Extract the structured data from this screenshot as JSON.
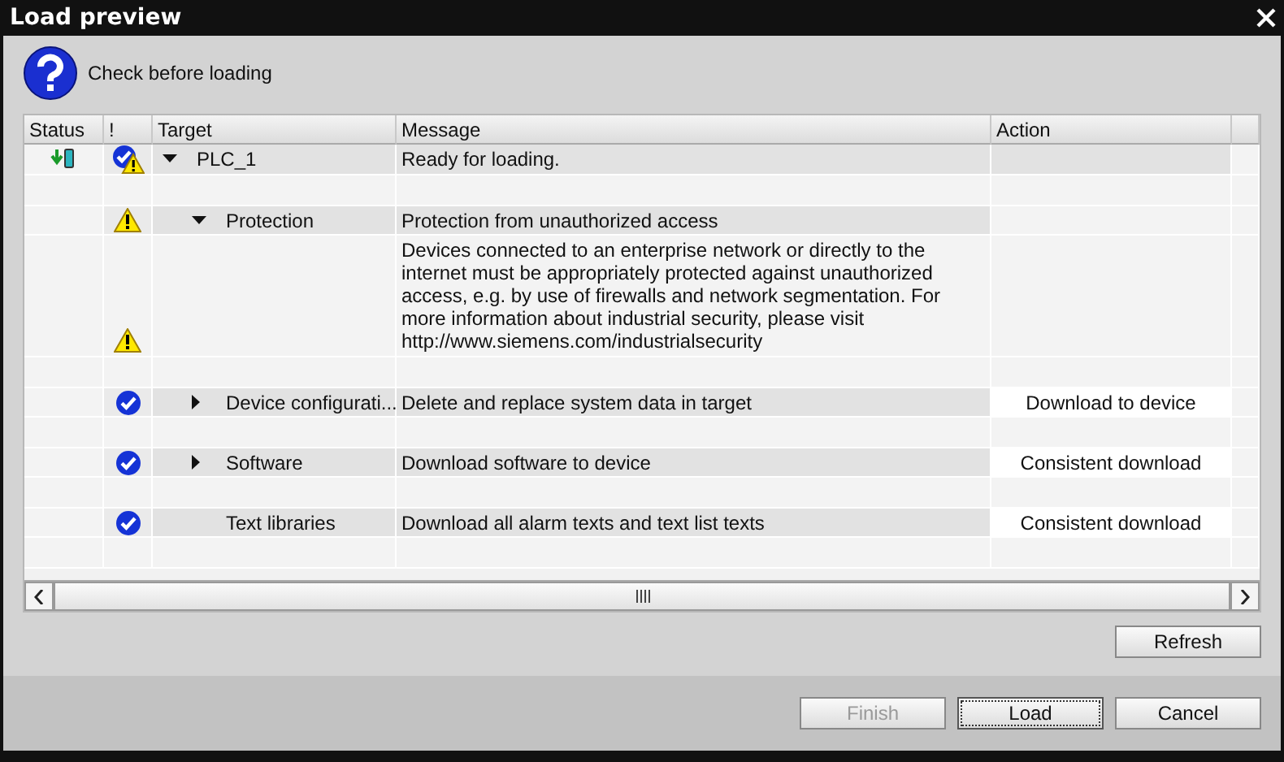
{
  "window": {
    "title": "Load preview"
  },
  "header": {
    "text": "Check before loading"
  },
  "table": {
    "columns": [
      "Status",
      "!",
      "Target",
      "Message",
      "Action"
    ],
    "rows": [
      {
        "target": "PLC_1",
        "download": true,
        "ok": true,
        "warning": true,
        "expanded": true,
        "message": "Ready for loading.",
        "spacer": true,
        "children": [
          {
            "target": "Protection",
            "download": false,
            "ok": false,
            "warning": true,
            "expanded": true,
            "message": "Protection from unauthorized access",
            "spacer": false,
            "children": [
              {
                "download": false,
                "ok": false,
                "warning": true,
                "message": "Devices connected to an enterprise network or directly to the internet must be appropriately protected against unauthorized access, e.g. by use of firewalls and network segmentation. For more information about industrial security, please visit http://www.siemens.com/industrialsecurity",
                "spacer": true
              }
            ]
          },
          {
            "target": "Device configurati...",
            "download": false,
            "ok": true,
            "warning": false,
            "expanded": false,
            "message": "Delete and replace system data in target",
            "action": "Download to device",
            "spacer": true
          },
          {
            "target": "Software",
            "download": false,
            "ok": true,
            "warning": false,
            "expanded": false,
            "message": "Download software to device",
            "action": "Consistent download",
            "spacer": true
          },
          {
            "target": "Text libraries",
            "download": false,
            "ok": true,
            "warning": false,
            "message": "Download all alarm texts and text list texts",
            "action": "Consistent download",
            "spacer": true
          }
        ]
      }
    ]
  },
  "buttons": [
    {
      "label": "Refresh",
      "kind": "side",
      "disabled": false,
      "focused": false
    },
    {
      "label": "Finish",
      "kind": "footer",
      "disabled": true,
      "focused": false
    },
    {
      "label": "Load",
      "kind": "footer",
      "disabled": false,
      "focused": true
    },
    {
      "label": "Cancel",
      "kind": "footer",
      "disabled": false,
      "focused": false
    }
  ]
}
